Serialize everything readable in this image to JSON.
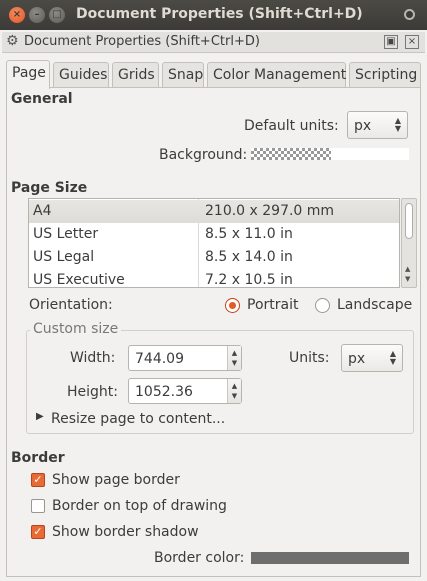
{
  "window": {
    "title": "Document Properties (Shift+Ctrl+D)",
    "close_glyph": "×",
    "min_glyph": "–",
    "max_glyph": "□"
  },
  "dock": {
    "title": "Document Properties (Shift+Ctrl+D)",
    "float_glyph": "▣",
    "close_glyph": "×"
  },
  "tabs": [
    "Page",
    "Guides",
    "Grids",
    "Snap",
    "Color Management",
    "Scripting"
  ],
  "general": {
    "heading": "General",
    "default_units_label": "Default units:",
    "default_units_value": "px",
    "background_label": "Background:"
  },
  "page_size": {
    "heading": "Page Size",
    "rows": [
      {
        "name": "A4",
        "size": "210.0 x 297.0 mm"
      },
      {
        "name": "US Letter",
        "size": "8.5 x 11.0 in"
      },
      {
        "name": "US Legal",
        "size": "8.5 x 14.0 in"
      },
      {
        "name": "US Executive",
        "size": "7.2 x 10.5 in"
      }
    ],
    "orientation_label": "Orientation:",
    "portrait_label": "Portrait",
    "landscape_label": "Landscape",
    "orientation_selected": "Portrait"
  },
  "custom_size": {
    "legend": "Custom size",
    "width_label": "Width:",
    "width_value": "744.09",
    "height_label": "Height:",
    "height_value": "1052.36",
    "units_label": "Units:",
    "units_value": "px",
    "resize_label": "Resize page to content..."
  },
  "border": {
    "heading": "Border",
    "show_page_border": {
      "label": "Show page border",
      "checked": true
    },
    "border_on_top": {
      "label": "Border on top of drawing",
      "checked": false
    },
    "show_border_shadow": {
      "label": "Show border shadow",
      "checked": true
    },
    "color_label": "Border color:",
    "color": "#6e6e6e"
  },
  "colors": {
    "accent": "#e35b26",
    "titlebar": "#3c3b37",
    "window_bg": "#f2f1f0"
  }
}
